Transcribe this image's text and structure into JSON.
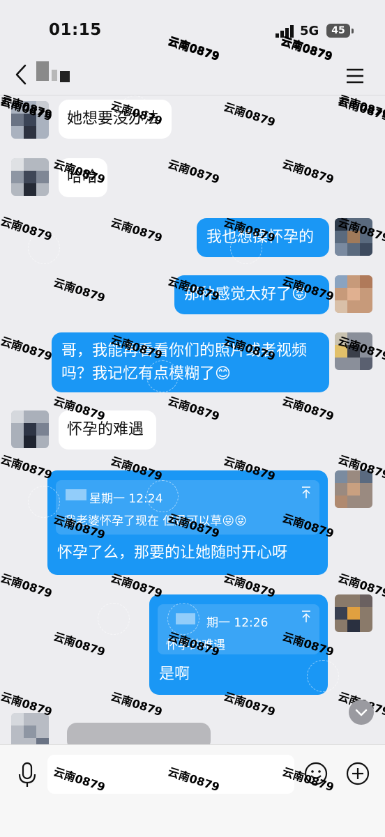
{
  "status_bar": {
    "time": "01:15",
    "network": "5G",
    "battery": "45"
  },
  "nav": {
    "title": ""
  },
  "messages": [
    {
      "side": "in",
      "text": "她想要没办法"
    },
    {
      "side": "in",
      "text": "哈哈"
    },
    {
      "side": "out",
      "text": "我也想操怀孕的"
    },
    {
      "side": "out",
      "text": "那种感觉太好了😝"
    },
    {
      "side": "out",
      "text_line1": "哥，我能再看看你们的照片或者视频",
      "text_line2": "吗？我记忆有点模糊了😊"
    },
    {
      "side": "in",
      "text": "怀孕的难遇"
    },
    {
      "side": "out",
      "quote": {
        "meta": "星期一 12:24",
        "text": "我老婆怀孕了现在  但是可以草😝😝"
      },
      "text": "怀孕了么，那要的让她随时开心呀"
    },
    {
      "side": "out",
      "quote": {
        "meta": "期一 12:26",
        "text": "怀孕的难遇"
      },
      "text": "是啊"
    }
  ],
  "watermark": {
    "text": "云南0879"
  },
  "input": {
    "placeholder": ""
  },
  "icons": [
    "back-icon",
    "menu-icon",
    "mic-icon",
    "emoji-icon",
    "plus-icon",
    "chevron-down-icon",
    "arrow-up-icon"
  ],
  "colors": {
    "background": "#ededf0",
    "outgoing_bubble": "#1a97f5",
    "incoming_bubble": "#ffffff"
  }
}
